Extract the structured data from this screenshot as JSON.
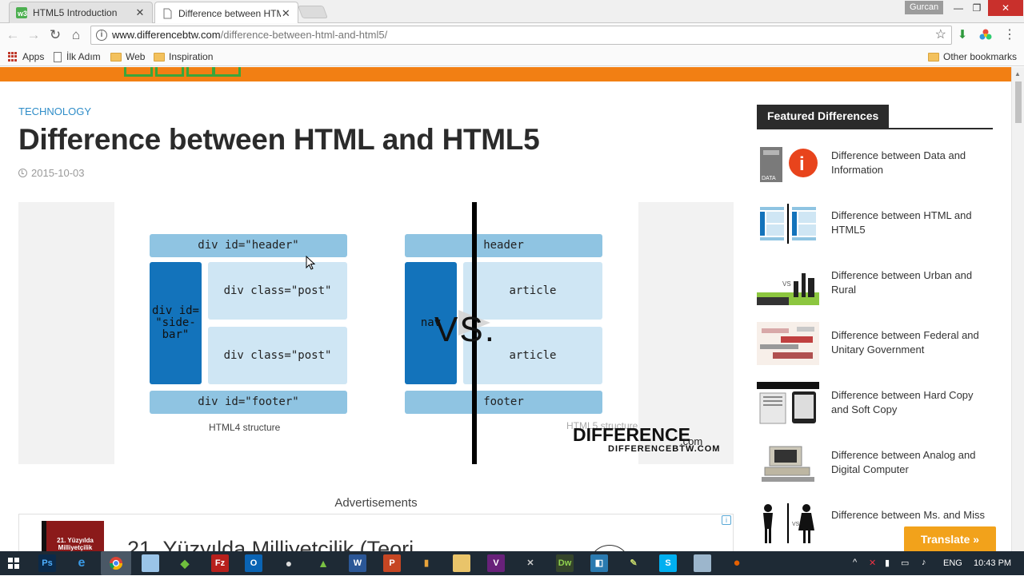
{
  "browser": {
    "tabs": [
      {
        "title": "HTML5 Introduction",
        "active": false
      },
      {
        "title": "Difference between HTM",
        "active": true
      }
    ],
    "profile_name": "Gurcan",
    "window_buttons": {
      "minimize": "—",
      "maximize": "❐",
      "close": "✕"
    },
    "url_domain": "www.differencebtw.com",
    "url_path": "/difference-between-html-and-html5/",
    "bookmarks": [
      {
        "label": "Apps",
        "icon": "apps-icon"
      },
      {
        "label": "İlk Adım",
        "icon": "page-icon"
      },
      {
        "label": "Web",
        "icon": "folder-icon"
      },
      {
        "label": "Inspiration",
        "icon": "folder-icon"
      }
    ],
    "other_bookmarks": "Other bookmarks"
  },
  "article": {
    "category": "TECHNOLOGY",
    "title": "Difference between HTML and HTML5",
    "date": "2015-10-03",
    "figure": {
      "html4": {
        "header": "div id=\"header\"",
        "sidebar": "div id=\n\"side-\nbar\"",
        "post1": "div class=\"post\"",
        "post2": "div class=\"post\"",
        "footer": "div id=\"footer\"",
        "caption": "HTML4 structure"
      },
      "html5": {
        "header": "header",
        "nav": "nav",
        "article1": "article",
        "article2": "article",
        "footer": "footer",
        "caption": "HTML5 structure"
      },
      "vs": "VS.",
      "watermark_main": "DIFFERENCE",
      "watermark_com": ".com",
      "watermark_sub": "DIFFERENCEBTW.COM"
    },
    "ads_label": "Advertisements",
    "ad": {
      "image_text": "21. Yüzyılda Milliyetçilik",
      "headline": "21. Yüzyılda Milliyetçilik (Teori",
      "choice_icon": "i"
    }
  },
  "sidebar": {
    "heading": "Featured Differences",
    "items": [
      {
        "title": "Difference between Data and Information"
      },
      {
        "title": "Difference between HTML and HTML5"
      },
      {
        "title": "Difference between Urban and Rural"
      },
      {
        "title": "Difference between Federal and Unitary Government"
      },
      {
        "title": "Difference between Hard Copy and Soft Copy"
      },
      {
        "title": "Difference between Analog and Digital Computer"
      },
      {
        "title": "Difference between Ms. and Miss"
      }
    ]
  },
  "translate_button": "Translate »",
  "taskbar": {
    "language": "ENG",
    "time": "10:43 PM"
  },
  "colors": {
    "accent_orange": "#f27f13",
    "link_blue": "#2f8dc8",
    "diagram_dark": "#1373bb",
    "diagram_mid": "#8fc4e2",
    "diagram_light": "#cfe6f4"
  }
}
